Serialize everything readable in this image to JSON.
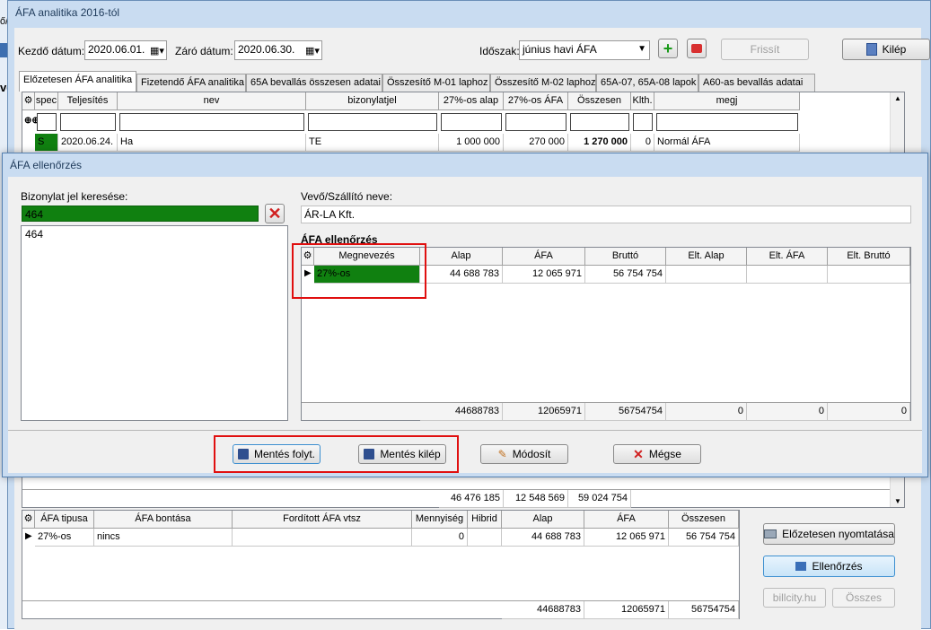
{
  "main_window": {
    "title": "ÁFA analitika 2016-tól",
    "start_date_label": "Kezdő dátum:",
    "start_date": "2020.06.01.",
    "end_date_label": "Záró dátum:",
    "end_date": "2020.06.30.",
    "period_label": "Időszak:",
    "period_value": "június havi ÁFA",
    "refresh_button": "Frissít",
    "exit_button": "Kilép",
    "tabs": [
      "Előzetesen ÁFA analitika",
      "Fizetendő ÁFA analitika",
      "65A bevallás összesen adatai",
      "Összesítő M-01 laphoz",
      "Összesítő M-02 laphoz",
      "65A-07, 65A-08 lapok",
      "A60-as bevallás adatai"
    ],
    "grid": {
      "columns": [
        "spec",
        "Teljesítés",
        "nev",
        "bizonylatjel",
        "27%-os alap",
        "27%-os ÁFA",
        "Összesen",
        "Klth.",
        "megj"
      ],
      "row": {
        "spec": "S",
        "date": "2020.06.24.",
        "name": "Ha",
        "doc": "TE",
        "base": "1 000 000",
        "vat": "270 000",
        "total": "1 270 000",
        "klth": "0",
        "note": "Normál ÁFA"
      },
      "totals": [
        "46 476 185",
        "12 548 569",
        "59 024 754"
      ]
    },
    "bottom_grid": {
      "columns": [
        "ÁFA tipusa",
        "ÁFA bontása",
        "Fordított ÁFA vtsz",
        "Mennyiség",
        "Hibrid",
        "Alap",
        "ÁFA",
        "Összesen"
      ],
      "row": {
        "type": "27%-os",
        "split": "nincs",
        "reverse": "",
        "qty": "0",
        "hybrid": "",
        "base": "44 688 783",
        "vat": "12 065 971",
        "total": "56 754 754"
      },
      "totals": [
        "44688783",
        "12065971",
        "56754754"
      ]
    },
    "print_button": "Előzetesen nyomtatása",
    "check_button": "Ellenőrzés",
    "billcity_button": "billcity.hu",
    "all_button": "Összes"
  },
  "dialog": {
    "title": "ÁFA ellenőrzés",
    "search_label": "Bizonylat jel keresése:",
    "search_value": "464",
    "list_items": [
      "464"
    ],
    "partner_label": "Vevő/Szállító neve:",
    "partner_value": "ÁR-LA Kft.",
    "section_title": "ÁFA ellenőrzés",
    "columns": [
      "Megnevezés",
      "Alap",
      "ÁFA",
      "Bruttó",
      "Elt. Alap",
      "Elt. ÁFA",
      "Elt. Bruttó"
    ],
    "row": {
      "name": "27%-os",
      "base": "44 688 783",
      "vat": "12 065 971",
      "gross": "56 754 754",
      "d_base": "",
      "d_vat": "",
      "d_gross": ""
    },
    "totals": [
      "44688783",
      "12065971",
      "56754754",
      "0",
      "0",
      "0"
    ],
    "save_continue_button": "Mentés folyt.",
    "save_exit_button": "Mentés kilép",
    "modify_button": "Módosít",
    "cancel_button": "Mégse"
  },
  "background": {
    "left_fragment_1": "ő/S",
    "left_fragment_2": "vé"
  }
}
